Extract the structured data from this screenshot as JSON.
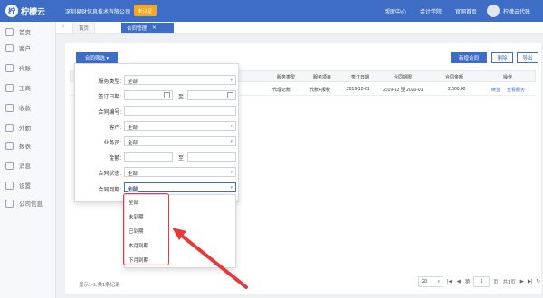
{
  "topbar": {
    "logo_mark": "柠",
    "logo_text": "柠檬云",
    "company": "深圳易财信息技术有限公司",
    "badge": "未认证",
    "nav": [
      "帮助中心",
      "会计学院",
      "官网首页"
    ],
    "user": "柠檬云代账"
  },
  "sidebar": {
    "items": [
      {
        "label": "首页",
        "icon": "home-icon"
      },
      {
        "label": "客户",
        "icon": "customer-icon"
      },
      {
        "label": "代账",
        "icon": "bookkeeping-icon"
      },
      {
        "label": "工商",
        "icon": "business-icon"
      },
      {
        "label": "收款",
        "icon": "payment-icon"
      },
      {
        "label": "外勤",
        "icon": "fieldwork-icon"
      },
      {
        "label": "报表",
        "icon": "report-icon"
      },
      {
        "label": "消息",
        "icon": "message-icon"
      },
      {
        "label": "设置",
        "icon": "settings-icon"
      },
      {
        "label": "公司信息",
        "icon": "company-icon"
      }
    ]
  },
  "tabs": {
    "home": "首页",
    "active": "合同管理",
    "close_glyph": "✕",
    "back_glyph": "<"
  },
  "toolbar": {
    "filter": "合同筛选 ▾",
    "new": "新增合同",
    "delete": "删除",
    "export": "导出"
  },
  "table": {
    "headers": [
      "服务类型",
      "服务项目",
      "签订日期",
      "合同期限",
      "合同金额",
      "操作"
    ],
    "rows": [
      {
        "service_type": "代理记账",
        "service_item": "代账+报税",
        "sign_date": "2019-12-01",
        "term": "2019-12 至 2020-01",
        "amount": "2,000.00",
        "actions": [
          "续签",
          "查看服务"
        ]
      }
    ]
  },
  "filter": {
    "labels": {
      "service_type": "服务类型:",
      "sign_date": "签订日期:",
      "contract_no": "合同编号:",
      "customer": "客户:",
      "salesperson": "业务员:",
      "amount": "金额:",
      "status": "合同状态:",
      "expiry": "合同到期:"
    },
    "values": {
      "service_type": "全部",
      "customer": "全部",
      "salesperson": "全部",
      "status": "全部",
      "expiry": "全部"
    },
    "range_sep": "至",
    "expiry_options": [
      "全部",
      "未到期",
      "已到期",
      "本月到期",
      "下月到期"
    ]
  },
  "footer": {
    "summary": "显示1-1,共1条记录",
    "page_size": "20",
    "page_label": "第",
    "page_value": "1",
    "page_unit": "页",
    "total": "共1页"
  },
  "colors": {
    "brand": "#3e6dc6",
    "badge": "#f5a623",
    "highlight": "#e63a3a"
  }
}
